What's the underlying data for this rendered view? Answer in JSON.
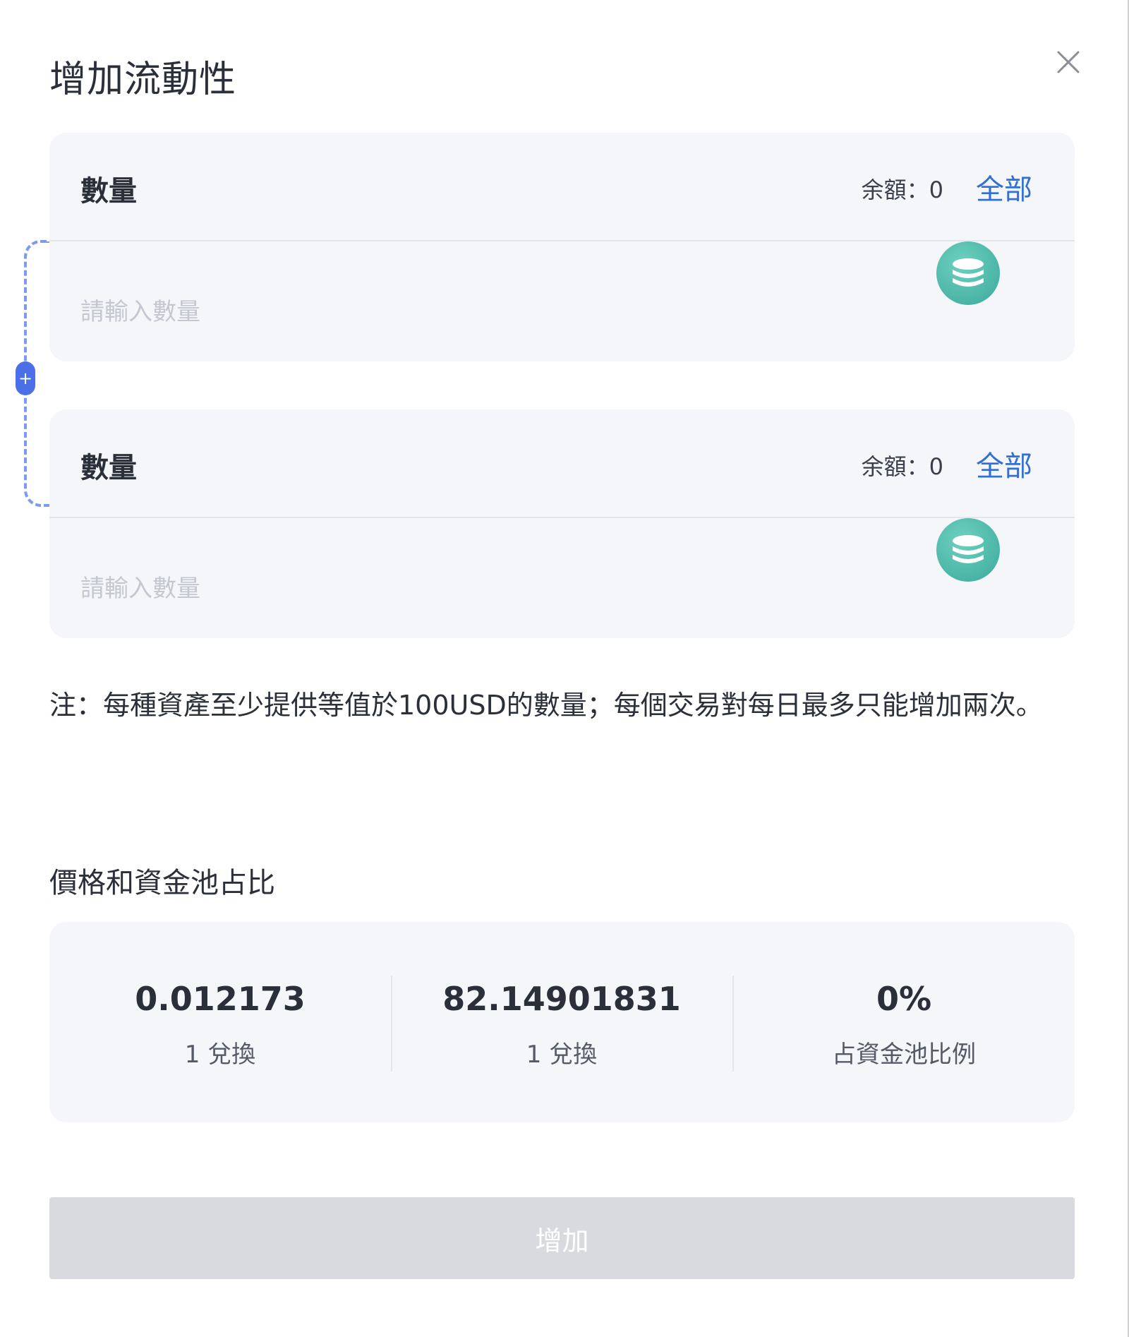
{
  "modal": {
    "title": "增加流動性"
  },
  "token_a": {
    "label": "數量",
    "balance_text": "余額：0",
    "max_label": "全部",
    "placeholder": "請輸入數量",
    "icon": "coin-stack-icon"
  },
  "token_b": {
    "label": "數量",
    "balance_text": "余額：0",
    "max_label": "全部",
    "placeholder": "請輸入數量",
    "icon": "coin-stack-icon"
  },
  "note": "注：每種資產至少提供等值於100USD的數量；每個交易對每日最多只能增加兩次。",
  "price_section": {
    "title": "價格和資金池占比",
    "stats": [
      {
        "value": "0.012173",
        "caption": "1 兌換"
      },
      {
        "value": "82.14901831",
        "caption": "1 兌換"
      },
      {
        "value": "0%",
        "caption": "占資金池比例"
      }
    ]
  },
  "submit": {
    "label": "增加"
  },
  "colors": {
    "accent": "#2f6fd6",
    "link_line": "#7a9bf0",
    "coin": "#3aa89b",
    "card_bg": "#f5f6fa",
    "button_disabled": "#d9dadf"
  }
}
